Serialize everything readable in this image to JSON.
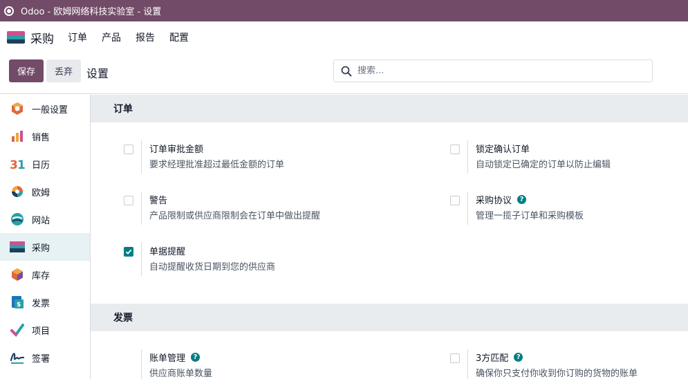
{
  "window": {
    "title": "Odoo - 欧姆网络科技实验室 - 设置"
  },
  "topmenu": {
    "app_name": "采购",
    "items": [
      "订单",
      "产品",
      "报告",
      "配置"
    ]
  },
  "controlbar": {
    "save_label": "保存",
    "discard_label": "丢弃",
    "breadcrumb": "设置",
    "search_placeholder": "搜索..."
  },
  "sidebar": {
    "items": [
      {
        "label": "一般设置",
        "icon": "general-settings-icon"
      },
      {
        "label": "销售",
        "icon": "sales-icon"
      },
      {
        "label": "日历",
        "icon": "calendar-icon"
      },
      {
        "label": "欧姆",
        "icon": "discuss-icon"
      },
      {
        "label": "网站",
        "icon": "website-icon"
      },
      {
        "label": "采购",
        "icon": "purchase-icon",
        "active": true
      },
      {
        "label": "库存",
        "icon": "inventory-icon"
      },
      {
        "label": "发票",
        "icon": "invoicing-icon"
      },
      {
        "label": "项目",
        "icon": "project-icon"
      },
      {
        "label": "签署",
        "icon": "sign-icon"
      }
    ]
  },
  "sections": {
    "orders": {
      "header": "订单",
      "settings": [
        {
          "title": "订单审批金额",
          "desc": "要求经理批准超过最低金额的订单",
          "checked": false
        },
        {
          "title": "锁定确认订单",
          "desc": "自动锁定已确定的订单以防止编辑",
          "checked": false
        },
        {
          "title": "警告",
          "desc": "产品限制或供应商限制会在订单中做出提醒",
          "checked": false
        },
        {
          "title": "采购协议",
          "desc": "管理一揽子订单和采购模板",
          "checked": false,
          "help": true
        },
        {
          "title": "单据提醒",
          "desc": "自动提醒收货日期到您的供应商",
          "checked": true
        }
      ]
    },
    "invoicing": {
      "header": "发票",
      "settings": [
        {
          "title": "账单管理",
          "desc": "供应商账单数量",
          "help": true
        },
        {
          "title": "3方匹配",
          "desc": "确保你只支付你收到你订购的货物的账单",
          "checked": false,
          "help": true
        }
      ]
    }
  },
  "colors": {
    "brand": "#714b67",
    "accent": "#017e84"
  }
}
